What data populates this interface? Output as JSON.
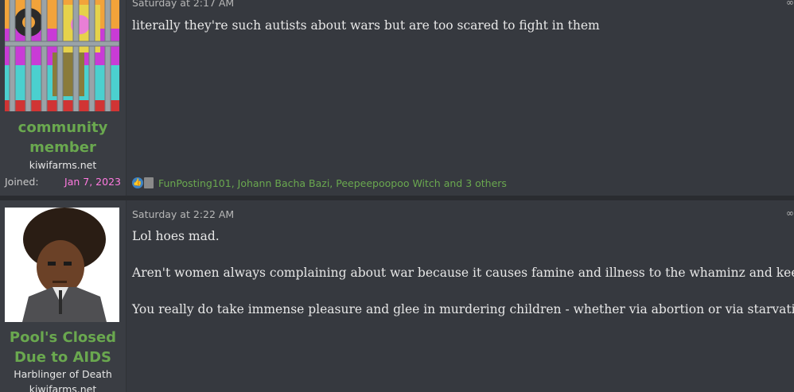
{
  "posts": [
    {
      "user": {
        "name_line1": "community",
        "name_line2": "member",
        "title": "kiwifarms.net",
        "joined_label": "Joined:",
        "joined_date": "Jan 7, 2023"
      },
      "date": "Saturday at 2:17 AM",
      "share_icon": "share-icon",
      "paragraphs": [
        "literally they're such autists about wars but are too scared to fight in them"
      ],
      "reactions": {
        "icons": [
          "like-icon",
          "meme-icon"
        ],
        "text": "FunPosting101, Johann Bacha Bazi, Peepeepoopoo Witch and 3 others"
      }
    },
    {
      "user": {
        "name_line1": "Pool's Closed",
        "name_line2": "Due to AIDS",
        "title": "Harblinger of Death",
        "site": "kiwifarms.net"
      },
      "date": "Saturday at 2:22 AM",
      "share_icon": "share-icon",
      "paragraphs": [
        "Lol hoes mad.",
        "Aren't women always complaining about war because it causes famine and illness to the whaminz and keedz?",
        "You really do take immense pleasure and glee in murdering children - whether via abortion or via starvation."
      ]
    }
  ]
}
